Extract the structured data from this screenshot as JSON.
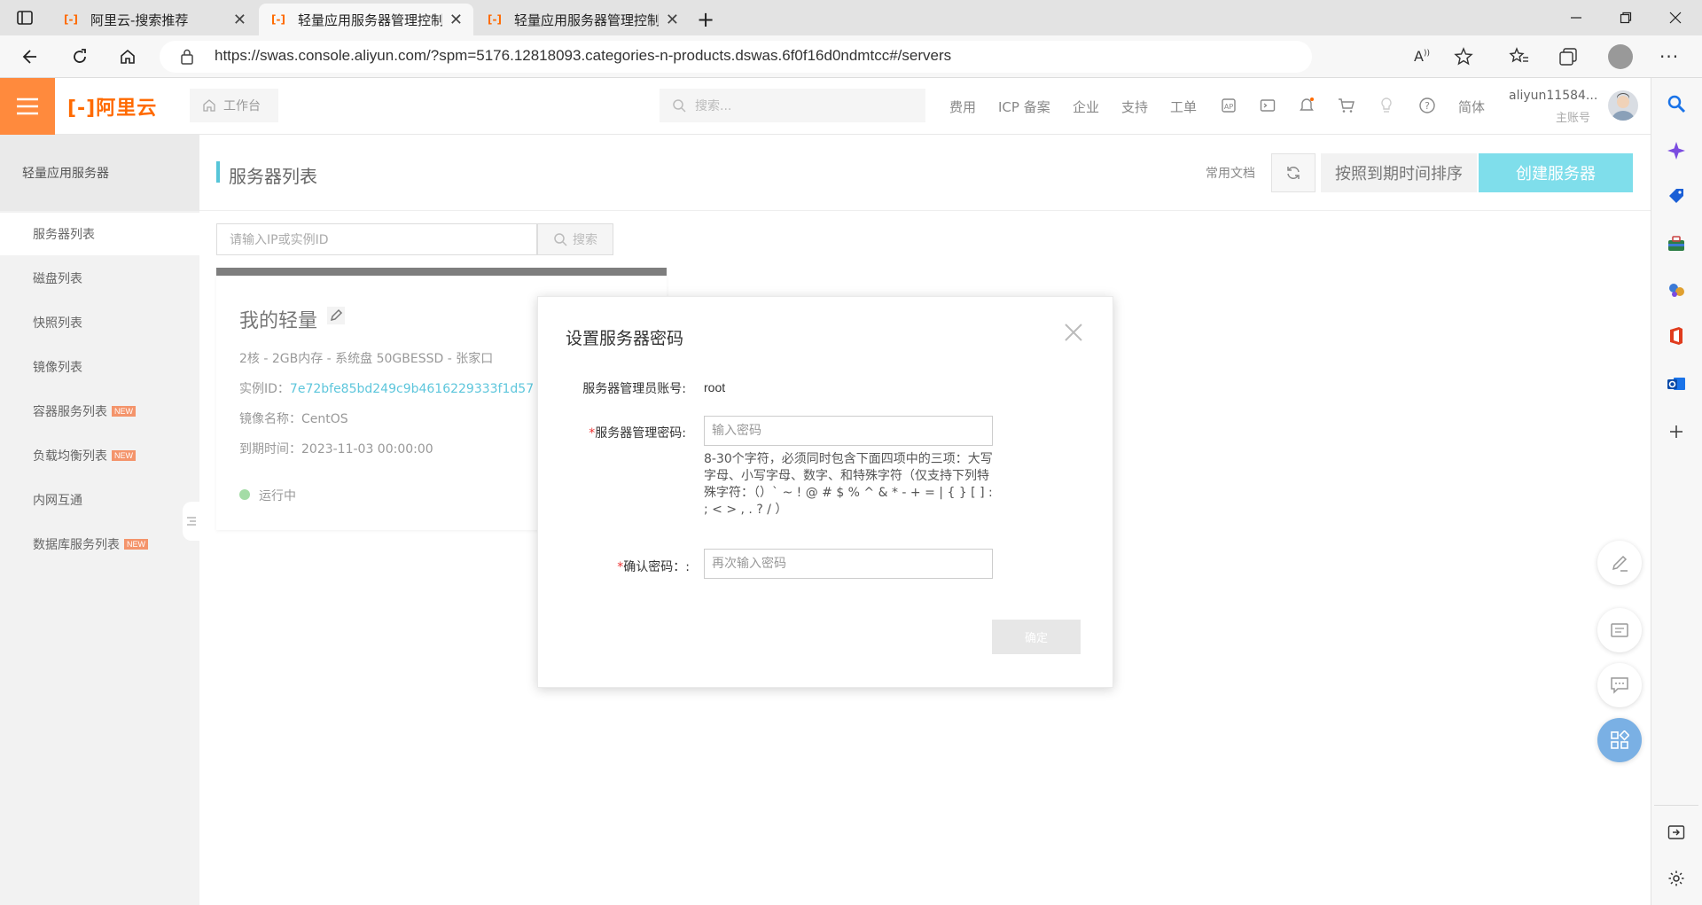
{
  "browser": {
    "tabs": [
      {
        "title": "阿里云-搜索推荐",
        "favicon": "[-]"
      },
      {
        "title": "轻量应用服务器管理控制台",
        "favicon": "[-]"
      },
      {
        "title": "轻量应用服务器管理控制台",
        "favicon": "[-]"
      }
    ],
    "url": "https://swas.console.aliyun.com/?spm=5176.12818093.categories-n-products.dswas.6f0f16d0ndmtcc#/servers"
  },
  "topbar": {
    "logo": "[-]阿里云",
    "workbench": "工作台",
    "search_placeholder": "搜索...",
    "links": [
      "费用",
      "ICP 备案",
      "企业",
      "支持",
      "工单"
    ],
    "lang": "简体",
    "username": "aliyun11584...",
    "role": "主账号",
    "accent": "#ff6a00"
  },
  "sidebar": {
    "title": "轻量应用服务器",
    "items": [
      {
        "label": "服务器列表",
        "badge": ""
      },
      {
        "label": "磁盘列表",
        "badge": ""
      },
      {
        "label": "快照列表",
        "badge": ""
      },
      {
        "label": "镜像列表",
        "badge": ""
      },
      {
        "label": "容器服务列表",
        "badge": "NEW"
      },
      {
        "label": "负载均衡列表",
        "badge": "NEW"
      },
      {
        "label": "内网互通",
        "badge": ""
      },
      {
        "label": "数据库服务列表",
        "badge": "NEW"
      }
    ]
  },
  "main": {
    "title": "服务器列表",
    "docs": "常用文档",
    "sort": "按照到期时间排序",
    "create": "创建服务器",
    "search_placeholder": "请输入IP或实例ID",
    "search_button": "搜索"
  },
  "card": {
    "name": "我的轻量",
    "spec": "2核 - 2GB内存 - 系统盘 50GBESSD - 张家口",
    "instance_label": "实例ID：",
    "instance_id": "7e72bfe85bd249c9b4616229333f1d57",
    "image_label": "镜像名称：",
    "image": "CentOS",
    "expire_label": "到期时间：",
    "expire": "2023-11-03 00:00:00",
    "status": "运行中"
  },
  "modal": {
    "title": "设置服务器密码",
    "account_label": "服务器管理员账号:",
    "account_value": "root",
    "required_mark": "*",
    "password_label": "服务器管理密码:",
    "password_placeholder": "输入密码",
    "hint": "8-30个字符，必须同时包含下面四项中的三项：大写字母、小写字母、数字、和特殊字符（仅支持下列特殊字符：（）` ~ ! @ # $ % ^ & * - + = | { } [ ] : ; < > , . ? / ）",
    "confirm_label": "确认密码：:",
    "confirm_placeholder": "再次输入密码",
    "ok": "确定"
  }
}
